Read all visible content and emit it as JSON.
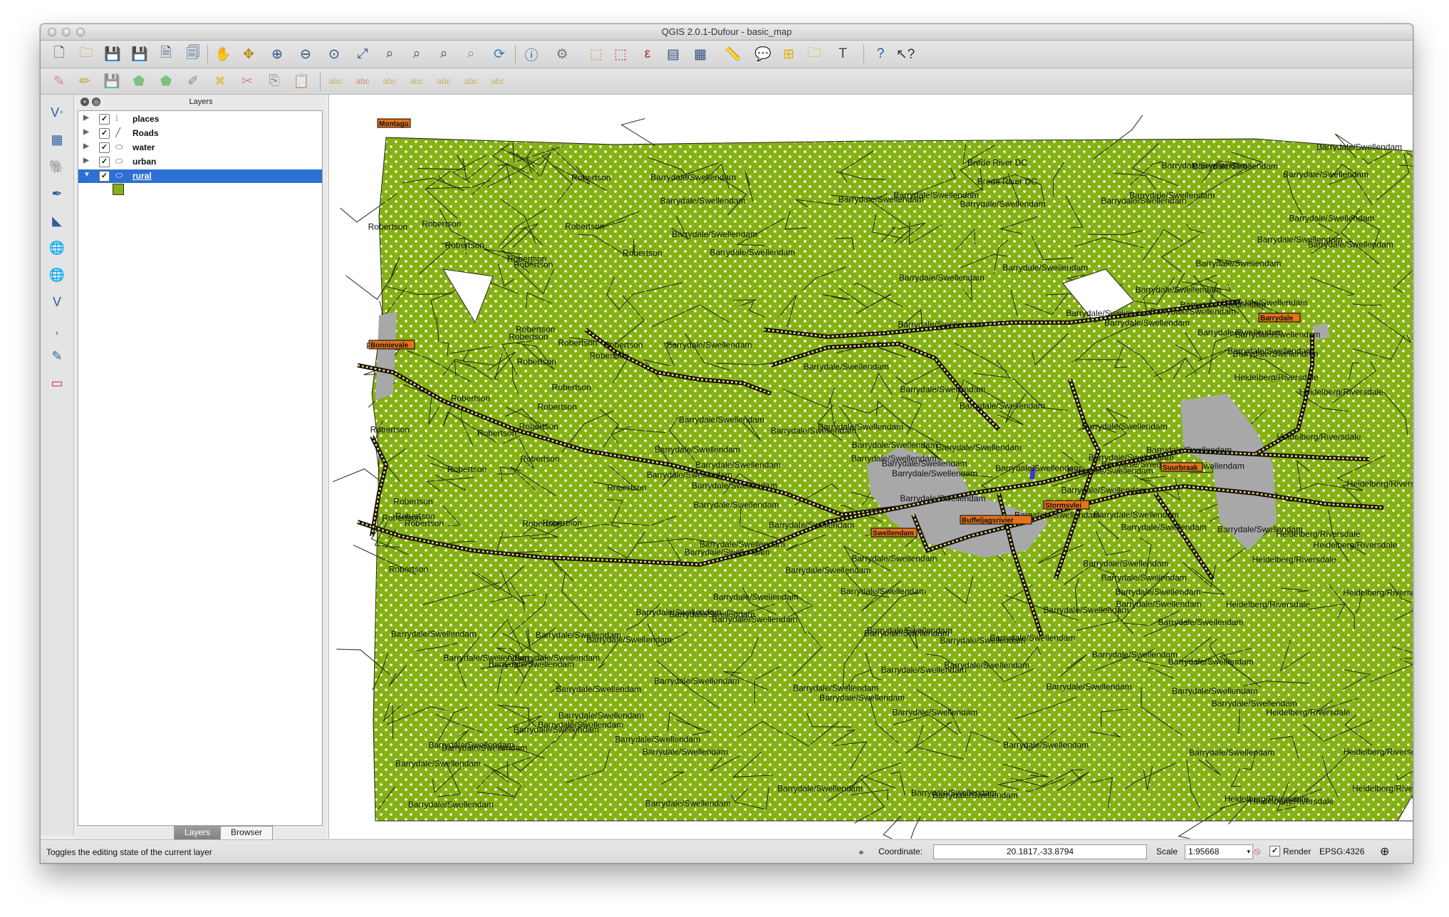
{
  "window": {
    "title": "QGIS 2.0.1-Dufour - basic_map"
  },
  "toolbar1": {
    "icons": [
      "new-project",
      "open-project",
      "save-project",
      "save-as",
      "new-print-composer",
      "composer-manager",
      "pan",
      "pan-to-selection",
      "zoom-in",
      "zoom-out",
      "zoom-actual",
      "zoom-full",
      "zoom-selection",
      "zoom-layer",
      "zoom-last",
      "zoom-next",
      "refresh",
      "identify",
      "select",
      "deselect",
      "field-calculator",
      "attribute-table",
      "stats",
      "measure",
      "map-tips",
      "new-bookmark",
      "show-bookmarks",
      "text-annotation",
      "help",
      "whats-this"
    ]
  },
  "toolbar2": {
    "icons": [
      "toggle-editing",
      "current-edits",
      "save-edits",
      "add-feature",
      "move-feature",
      "node-tool",
      "delete-selected",
      "cut",
      "copy",
      "paste",
      "label",
      "pin-labels",
      "show-labels",
      "move-label",
      "rotate-label",
      "change-label"
    ]
  },
  "layers_panel": {
    "title": "Layers",
    "layers": [
      {
        "name": "places",
        "checked": true,
        "symbol": "points",
        "selected": false
      },
      {
        "name": "Roads",
        "checked": true,
        "symbol": "lines",
        "selected": false
      },
      {
        "name": "water",
        "checked": true,
        "symbol": "polygon",
        "selected": false
      },
      {
        "name": "urban",
        "checked": true,
        "symbol": "polygon",
        "selected": false
      },
      {
        "name": "rural",
        "checked": true,
        "symbol": "polygon",
        "selected": true
      }
    ],
    "rural_color": "#86b114",
    "tabs": [
      "Layers",
      "Browser"
    ],
    "active_tab": "Layers"
  },
  "map": {
    "fill_color": "#86b114",
    "urban_color": "#a8a8a8",
    "places": [
      "Montagu",
      "Bonnievale",
      "Barrydale",
      "Suurbraak",
      "Swellendam",
      "Buffeljagsrivier",
      "Stormsvlei"
    ],
    "region_labels": [
      "Robertson",
      "Brede River DC",
      "Barrydale/Swellendam",
      "Heidelberg/Riversdale"
    ]
  },
  "status": {
    "message": "Toggles the editing state of the current layer",
    "coordinate_label": "Coordinate:",
    "coordinate": "20.1817,-33.8794",
    "scale_label": "Scale",
    "scale": "1:95668",
    "render_label": "Render",
    "render_checked": true,
    "crs": "EPSG:4326"
  }
}
